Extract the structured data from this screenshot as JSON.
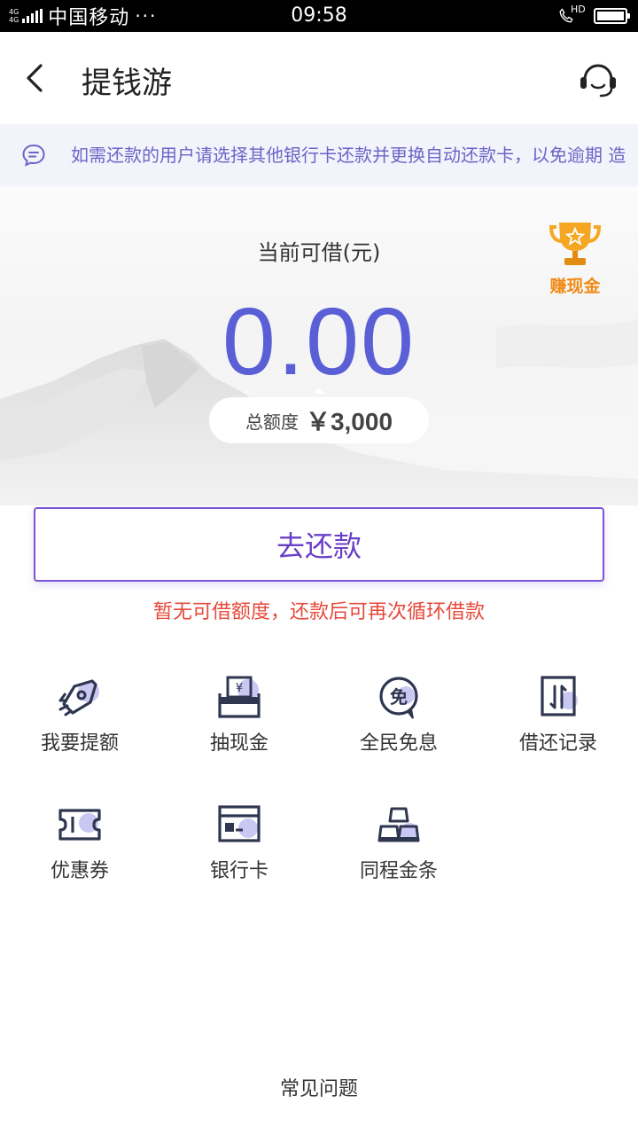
{
  "status_bar": {
    "network_top": "4G",
    "network_bottom": "4G",
    "carrier": "中国移动",
    "carrier_dots": "···",
    "time": "09:58",
    "call_hd": "HD"
  },
  "header": {
    "title": "提钱游"
  },
  "notice": {
    "text": "如需还款的用户请选择其他银行卡还款并更换自动还款卡，以免逾期 造"
  },
  "hero": {
    "available_label": "当前可借(元)",
    "amount": "0.00",
    "total_label": "总额度",
    "total_value": "￥3,000",
    "earn_cash_label": "赚现金"
  },
  "repay": {
    "button_label": "去还款",
    "hint": "暂无可借额度，还款后可再次循环借款"
  },
  "menu": {
    "items": [
      {
        "label": "我要提额",
        "icon": "rocket-icon"
      },
      {
        "label": "抽现金",
        "icon": "cash-draw-icon"
      },
      {
        "label": "全民免息",
        "icon": "interest-free-icon"
      },
      {
        "label": "借还记录",
        "icon": "records-icon"
      },
      {
        "label": "优惠券",
        "icon": "coupon-icon"
      },
      {
        "label": "银行卡",
        "icon": "bank-card-icon"
      },
      {
        "label": "同程金条",
        "icon": "gold-bars-icon"
      }
    ]
  },
  "footer": {
    "faq": "常见问题"
  },
  "colors": {
    "accent": "#5b5fd6",
    "button_border": "#7a55d4",
    "hint_red": "#e5493a",
    "earn_orange": "#f08a14",
    "notice_bg": "#f3f3fb"
  }
}
